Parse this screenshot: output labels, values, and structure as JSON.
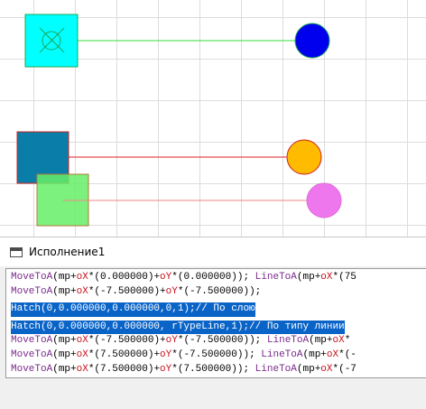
{
  "window": {
    "title": "Исполнение1"
  },
  "colors": {
    "grid": "#dcdcdc",
    "cyan_square": "#00ffff",
    "green_line": "#33dd33",
    "blue_circle": "#0000ee",
    "teal_square": "#0a7ea8",
    "red_line": "#dd2222",
    "yellow_circle": "#ffbb00",
    "green_square": "#66ee66",
    "pink_line": "#ee8888",
    "magenta_circle": "#ee77ee",
    "selection": "#0a64c8"
  },
  "code": {
    "lines": [
      "MoveToA(mp+oX*(0.000000)+oY*(0.000000)); LineToA(mp+oX*(75",
      "MoveToA(mp+oX*(-7.500000)+oY*(-7.500000));",
      "Hatch(0,0.000000,0.000000,0,1);// По слою",
      "Hatch(0,0.000000,0.000000, rTypeLine,1);// По типу линии",
      "MoveToA(mp+oX*(-7.500000)+oY*(-7.500000)); LineToA(mp+oX*",
      "MoveToA(mp+oX*(7.500000)+oY*(-7.500000)); LineToA(mp+oX*(-",
      "MoveToA(mp+oX*(7.500000)+oY*(7.500000)); LineToA(mp+oX*(-7",
      "MoveToA(mp+oX*(-7.500000)+oY*(7.500000)); LineToA(mp+oX*(-7"
    ],
    "selected_lines": [
      2,
      3
    ],
    "function_names": [
      "MoveToA",
      "LineToA"
    ],
    "variable_names": [
      "oX",
      "oY"
    ]
  }
}
